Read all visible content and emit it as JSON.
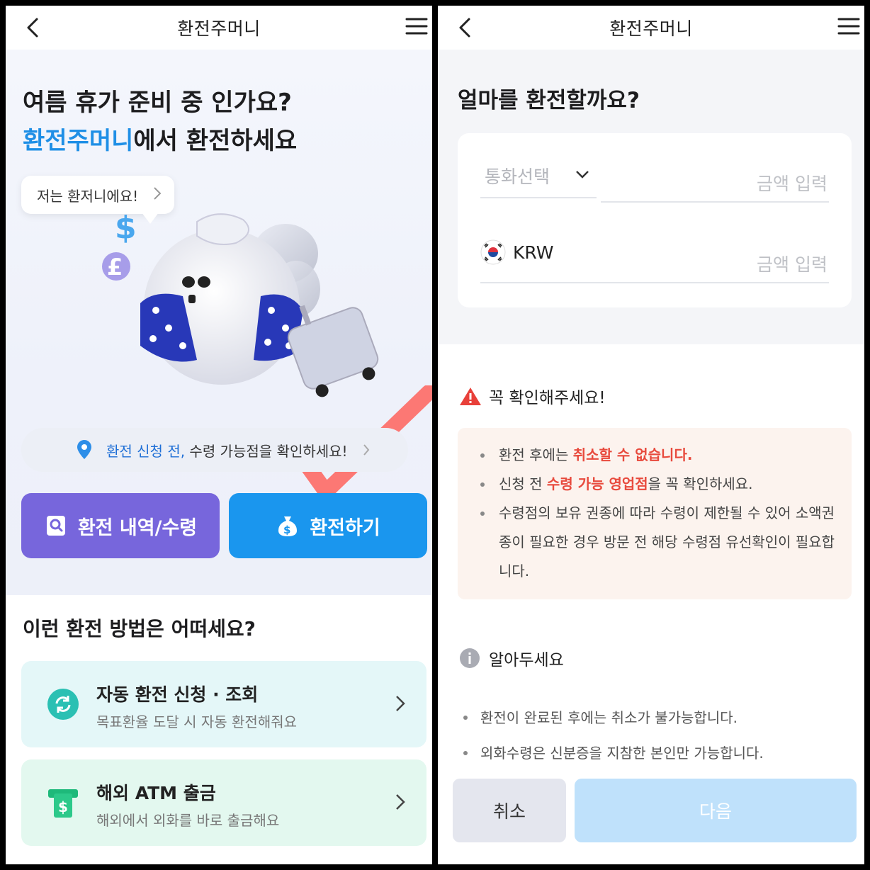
{
  "left": {
    "header": {
      "title": "환전주머니"
    },
    "headline": {
      "line1": "여름 휴가 준비 중 인가요?",
      "brand": "환전주머니",
      "line2_rest": "에서 환전하세요"
    },
    "bubble": {
      "text": "저는 환저니에요!"
    },
    "notice": {
      "bold": "환전 신청 전,",
      "rest": " 수령 가능점을 확인하세요!"
    },
    "buttons": {
      "history": "환전 내역/수령",
      "exchange": "환전하기"
    },
    "section_title": "이런 환전 방법은 어떠세요?",
    "cards": [
      {
        "title": "자동 환전 신청 · 조회",
        "subtitle": "목표환율 도달 시 자동 환전해줘요"
      },
      {
        "title": "해외 ATM 출금",
        "subtitle": "해외에서 외화를 바로 출금해요"
      }
    ],
    "colors": {
      "brand_blue": "#1f8fe6",
      "history_btn": "#7766dc",
      "exchange_btn": "#1a96ee"
    }
  },
  "right": {
    "header": {
      "title": "환전주머니"
    },
    "headline": "얼마를 환전할까요?",
    "form": {
      "currency_placeholder": "통화선택",
      "amount_placeholder_1": "금액 입력",
      "krw_label": "KRW",
      "amount_placeholder_2": "금액 입력"
    },
    "warning": {
      "title": "꼭 확인해주세요!",
      "items": [
        {
          "pre": "환전 후에는 ",
          "red": "취소할 수 없습니다.",
          "post": ""
        },
        {
          "pre": "신청 전 ",
          "red": "수령 가능 영업점",
          "post": "을 꼭 확인하세요."
        },
        {
          "pre": "수령점의 보유 권종에 따라 수령이 제한될 수 있어 소액권종이 필요한 경우 방문 전 해당 수령점 유선확인이 필요합니다.",
          "red": "",
          "post": ""
        }
      ]
    },
    "info": {
      "title": "알아두세요",
      "items": [
        "환전이 완료된 후에는 취소가 불가능합니다.",
        "외화수령은 신분증을 지참한 본인만 가능합니다."
      ]
    },
    "footer": {
      "cancel": "취소",
      "next": "다음"
    },
    "colors": {
      "warning_red": "#e84a3d",
      "next_disabled": "#bfe1fb"
    }
  }
}
